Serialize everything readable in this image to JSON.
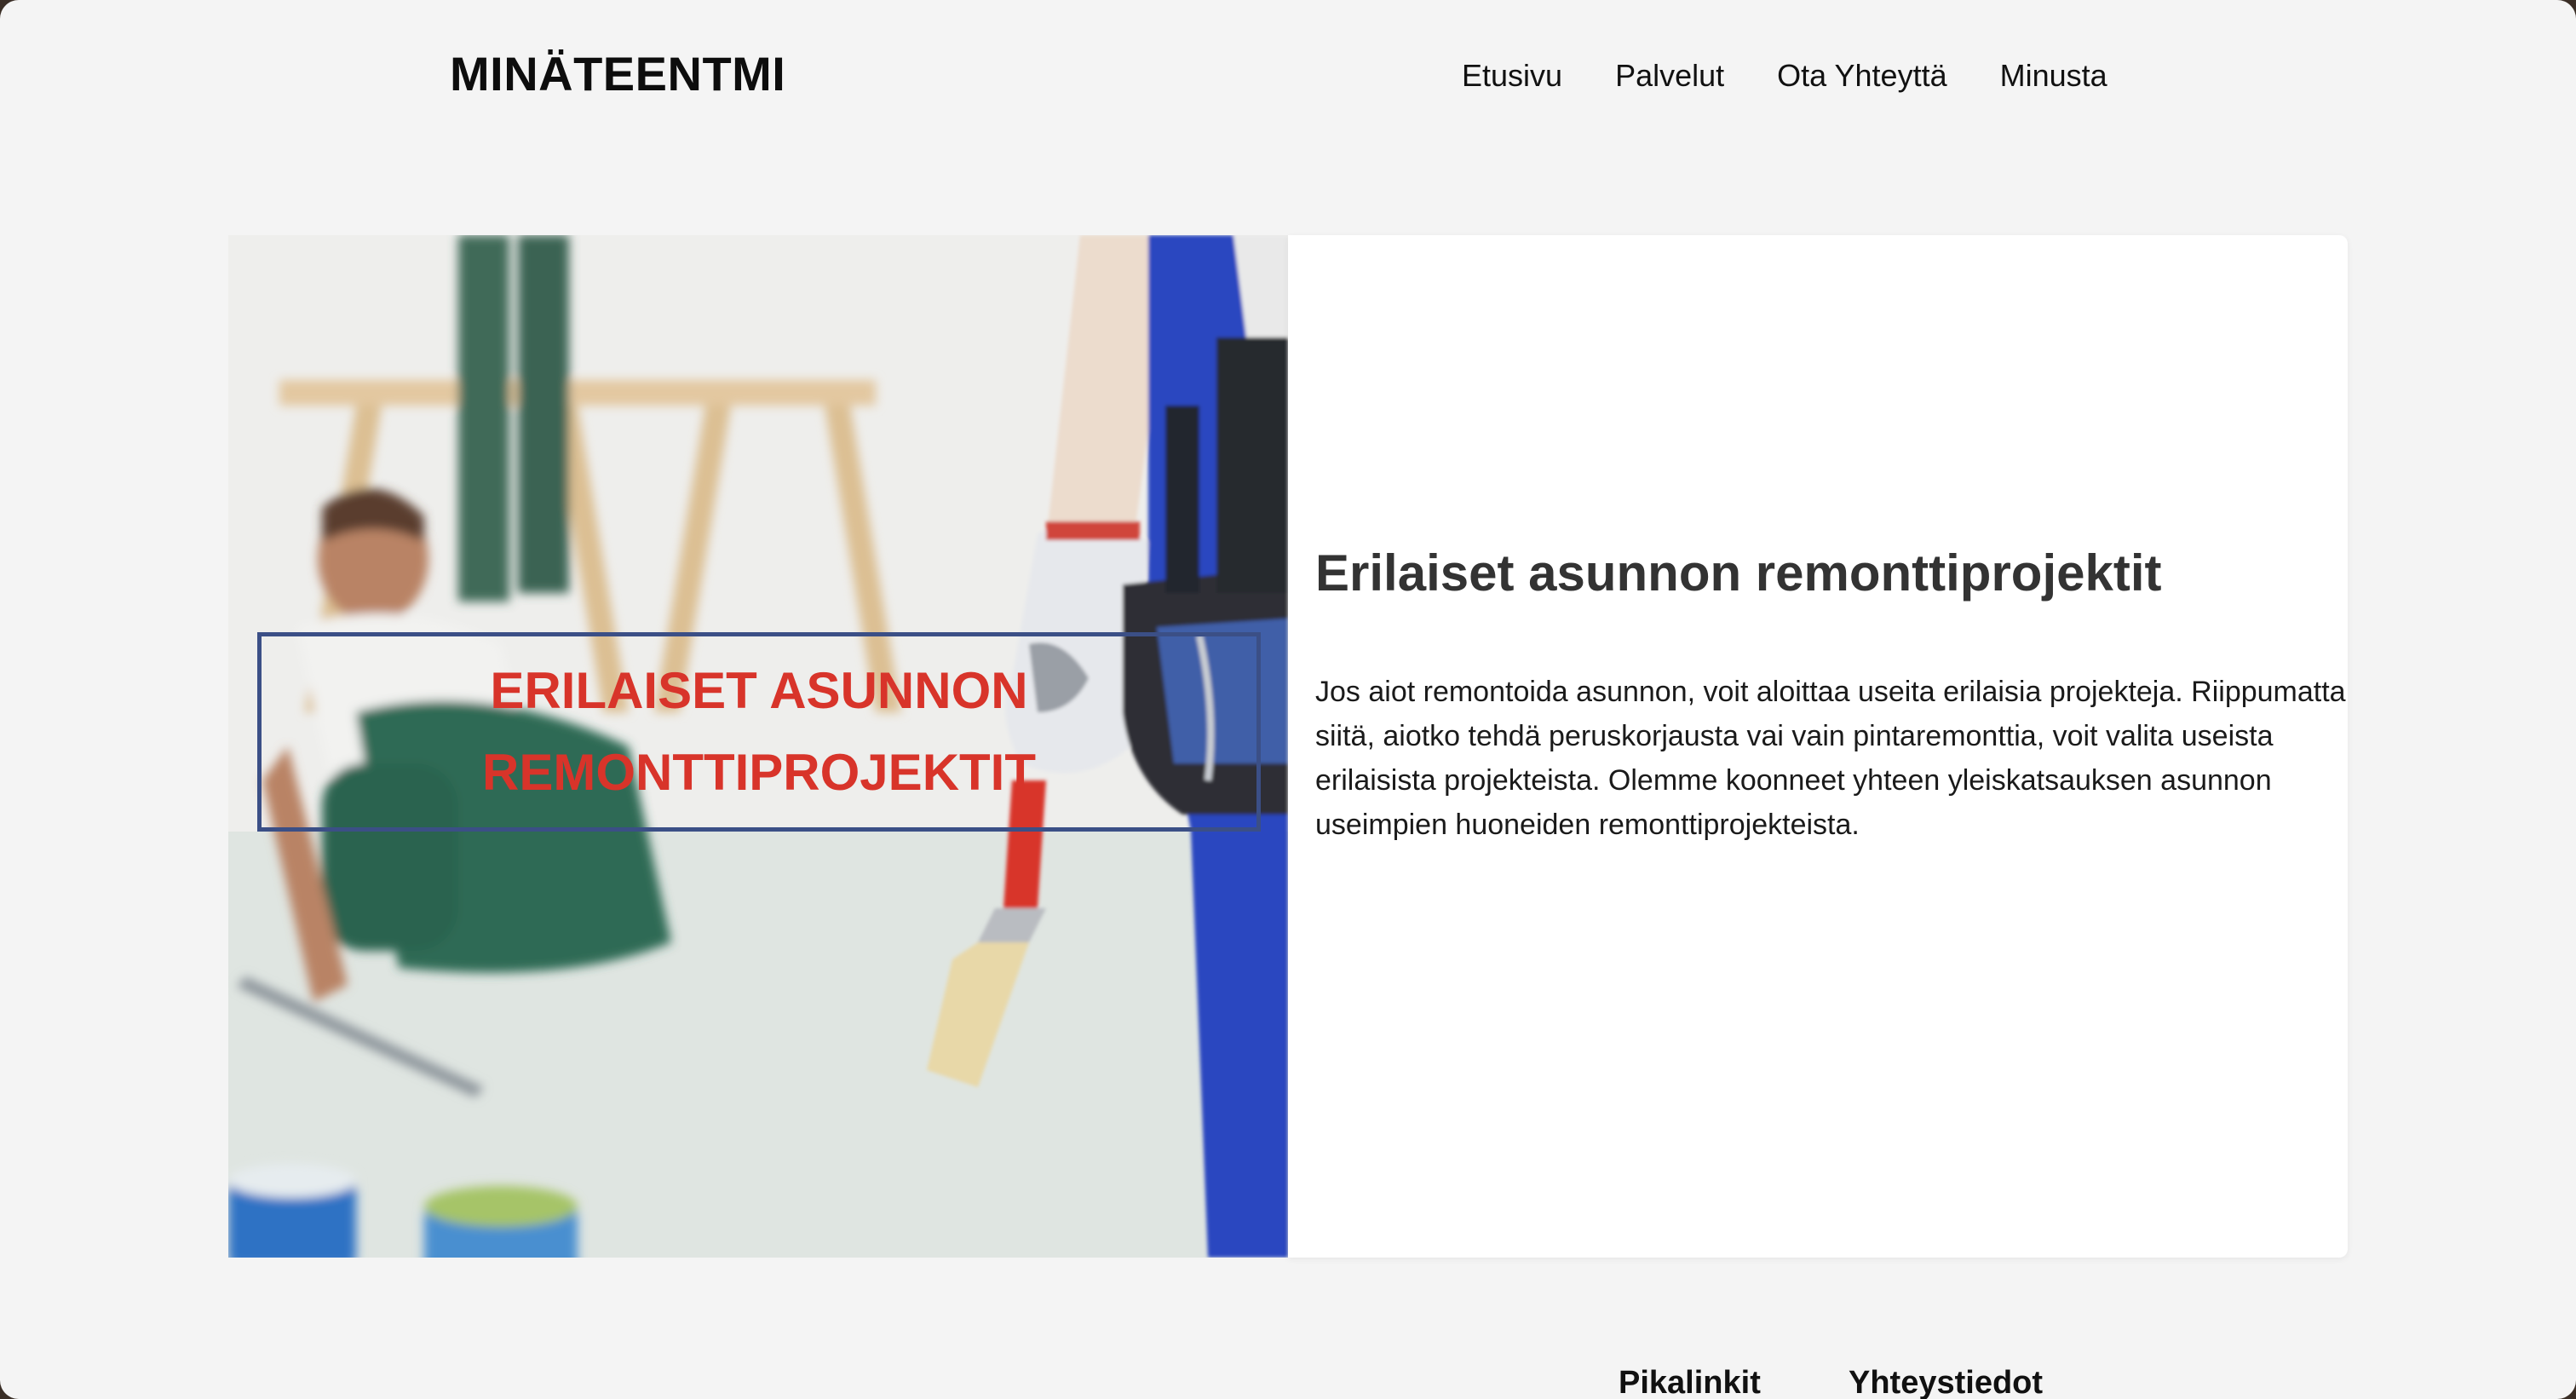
{
  "header": {
    "brand": "MINÄTEENTMI",
    "nav": [
      "Etusivu",
      "Palvelut",
      "Ota Yhteyttä",
      "Minusta"
    ]
  },
  "hero": {
    "image_overlay_title": "ERILAISET ASUNNON REMONTTIPROJEKTIT",
    "heading": "Erilaiset asunnon remonttiprojektit",
    "paragraph": "Jos aiot remontoida asunnon, voit aloittaa useita erilaisia projekteja. Riippumatta siitä, aiotko tehdä peruskorjausta vai vain pintaremonttia, voit valita useista erilaisista projekteista. Olemme koonneet yhteen yleiskatsauksen asunnon useimpien huoneiden remonttiprojekteista."
  },
  "footer": {
    "quicklinks_title": "Pikalinkit",
    "contact_title": "Yhteystiedot"
  },
  "colors": {
    "page_bg": "#f4f4f4",
    "overlay_border": "#3b4f86",
    "overlay_text": "#d8342a",
    "heading_text": "#333333"
  }
}
